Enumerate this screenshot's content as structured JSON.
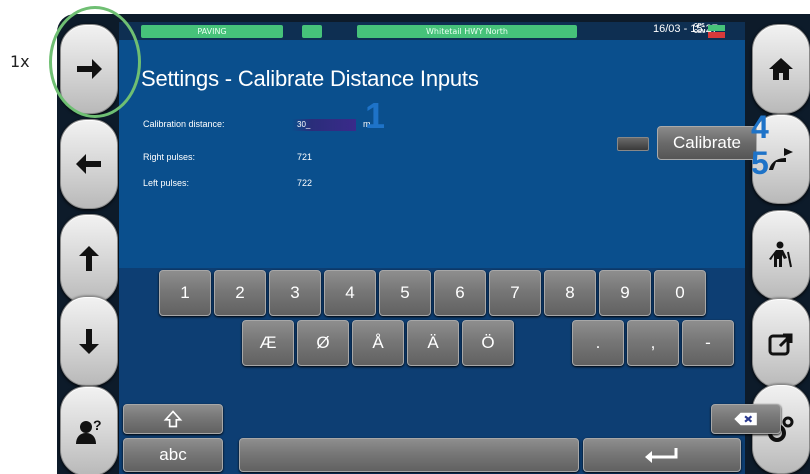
{
  "outside_label": "1x",
  "status_bar": {
    "mode": "PAVING",
    "road": "Whitetail HWY North",
    "datetime": "16/03 - 15:27",
    "gps_label": "GPS",
    "gsm_label": "GSM",
    "colors": {
      "ok": "#46c27a",
      "error": "#d93a3a"
    }
  },
  "title": "Settings - Calibrate Distance Inputs",
  "fields": {
    "calibration_distance_label": "Calibration distance:",
    "calibration_distance_value": "30_",
    "unit": "m",
    "right_pulses_label": "Right pulses:",
    "right_pulses_value": "721",
    "left_pulses_label": "Left pulses:",
    "left_pulses_value": "722"
  },
  "annotations": [
    "1",
    "4",
    "5"
  ],
  "calibrate_label": "Calibrate",
  "left_nav": [
    "arrow-right-icon",
    "arrow-left-icon",
    "arrow-up-icon",
    "arrow-down-icon",
    "user-help-icon"
  ],
  "right_nav": [
    "home-icon",
    "paver-icon",
    "worker-icon",
    "export-icon",
    "settings-icon"
  ],
  "keyboard": {
    "digits": [
      "1",
      "2",
      "3",
      "4",
      "5",
      "6",
      "7",
      "8",
      "9",
      "0"
    ],
    "letters": [
      "Æ",
      "Ø",
      "Å",
      "Ä",
      "Ö"
    ],
    "punct": [
      ".",
      ",",
      "-"
    ],
    "shift_icon": "shift-icon",
    "backspace_icon": "backspace-icon",
    "abc_label": "abc",
    "enter_icon": "enter-icon"
  }
}
